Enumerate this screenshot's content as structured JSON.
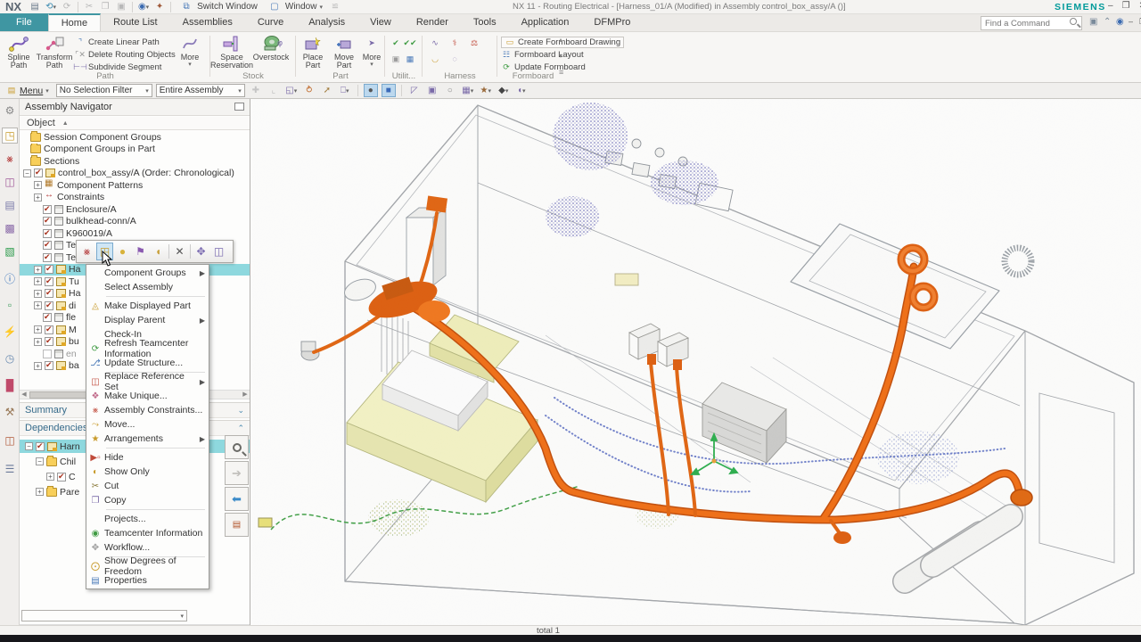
{
  "window": {
    "app_logo": "NX",
    "title": "NX 11 - Routing Electrical - [Harness_01/A (Modified) in Assembly control_box_assy/A  ()]",
    "brand": "SIEMENS",
    "switch_window": "Switch Window",
    "window_menu": "Window"
  },
  "tabs": {
    "file": "File",
    "items": [
      "Home",
      "Route List",
      "Assemblies",
      "Curve",
      "Analysis",
      "View",
      "Render",
      "Tools",
      "Application",
      "DFMPro"
    ],
    "active": "Home",
    "find_placeholder": "Find a Command"
  },
  "ribbon": {
    "path": {
      "label": "Path",
      "spline": "Spline Path",
      "transform": "Transform Path",
      "create_linear": "Create Linear Path",
      "delete_routing": "Delete Routing Objects",
      "subdivide": "Subdivide Segment",
      "more": "More"
    },
    "stock": {
      "label": "Stock",
      "space": "Space Reservation",
      "overstock": "Overstock",
      "more": "More"
    },
    "part": {
      "label": "Part",
      "place": "Place Part",
      "move": "Move Part",
      "more": "More"
    },
    "utilities": {
      "label": "Utilit..."
    },
    "harness": {
      "label": "Harness"
    },
    "formboard": {
      "label": "Formboard",
      "create": "Create Formboard Drawing",
      "layout": "Formboard Layout",
      "update": "Update Formboard"
    }
  },
  "toolbar": {
    "menu": "Menu",
    "selection_filter": "No Selection Filter",
    "scope": "Entire Assembly"
  },
  "navigator": {
    "title": "Assembly Navigator",
    "column": "Object",
    "rows": [
      {
        "label": "Session Component Groups"
      },
      {
        "label": "Component Groups in Part"
      },
      {
        "label": "Sections"
      },
      {
        "label": "control_box_assy/A (Order: Chronological)"
      },
      {
        "label": "Component Patterns"
      },
      {
        "label": "Constraints"
      },
      {
        "label": "Enclosure/A"
      },
      {
        "label": "bulkhead-conn/A"
      },
      {
        "label": "K960019/A"
      },
      {
        "label": "Te"
      },
      {
        "label": "Te"
      },
      {
        "label": "Ha"
      },
      {
        "label": "Tu"
      },
      {
        "label": "Ha"
      },
      {
        "label": "di"
      },
      {
        "label": "fle"
      },
      {
        "label": "M"
      },
      {
        "label": "bu"
      },
      {
        "label": "en"
      },
      {
        "label": "ba"
      }
    ],
    "summary": "Summary",
    "dependencies": "Dependencies",
    "dep_rows": [
      {
        "label": "Harn"
      },
      {
        "label": "Chil"
      },
      {
        "label": "C"
      },
      {
        "label": "Pare"
      }
    ]
  },
  "mini_toolbar": {
    "icons": [
      "assembly-constraints",
      "open-in-window",
      "work-part",
      "visibility-flag",
      "show-parents",
      "delete",
      "move-component",
      "export"
    ]
  },
  "context_menu": {
    "items": [
      {
        "label": "Component Groups",
        "submenu": true
      },
      {
        "label": "Select Assembly"
      },
      {
        "label": "Make Displayed Part",
        "icon": "make-displayed-part-icon"
      },
      {
        "label": "Display Parent",
        "submenu": true
      },
      {
        "label": "Check-In"
      },
      {
        "label": "Refresh Teamcenter Information",
        "icon": "refresh-teamcenter-icon"
      },
      {
        "label": "Update Structure...",
        "icon": "update-structure-icon"
      },
      {
        "label": "Replace Reference Set",
        "icon": "replace-reference-set-icon",
        "submenu": true
      },
      {
        "label": "Make Unique...",
        "icon": "make-unique-icon"
      },
      {
        "label": "Assembly Constraints...",
        "icon": "assembly-constraints-icon"
      },
      {
        "label": "Move...",
        "icon": "move-icon"
      },
      {
        "label": "Arrangements",
        "icon": "arrangements-icon",
        "submenu": true
      },
      {
        "label": "Hide",
        "icon": "hide-icon"
      },
      {
        "label": "Show Only",
        "icon": "show-only-icon"
      },
      {
        "label": "Cut",
        "icon": "cut-icon"
      },
      {
        "label": "Copy",
        "icon": "copy-icon"
      },
      {
        "label": "Projects..."
      },
      {
        "label": "Teamcenter Information",
        "icon": "teamcenter-info-icon"
      },
      {
        "label": "Workflow...",
        "icon": "workflow-icon"
      },
      {
        "label": "Show Degrees of Freedom",
        "icon": "show-dof-icon"
      },
      {
        "label": "Properties",
        "icon": "properties-icon"
      }
    ]
  },
  "status": {
    "total": "total 1"
  },
  "colors": {
    "accent_teal": "#3f96a2",
    "brand_teal": "#019a9a",
    "selection": "#8ed8de",
    "harness_orange": "#e06614",
    "pcb_yellow": "#f2f1c4",
    "wire_blue": "#5b6ec2",
    "curve_green": "#43a048",
    "cloud_purple": "#6565b5"
  }
}
